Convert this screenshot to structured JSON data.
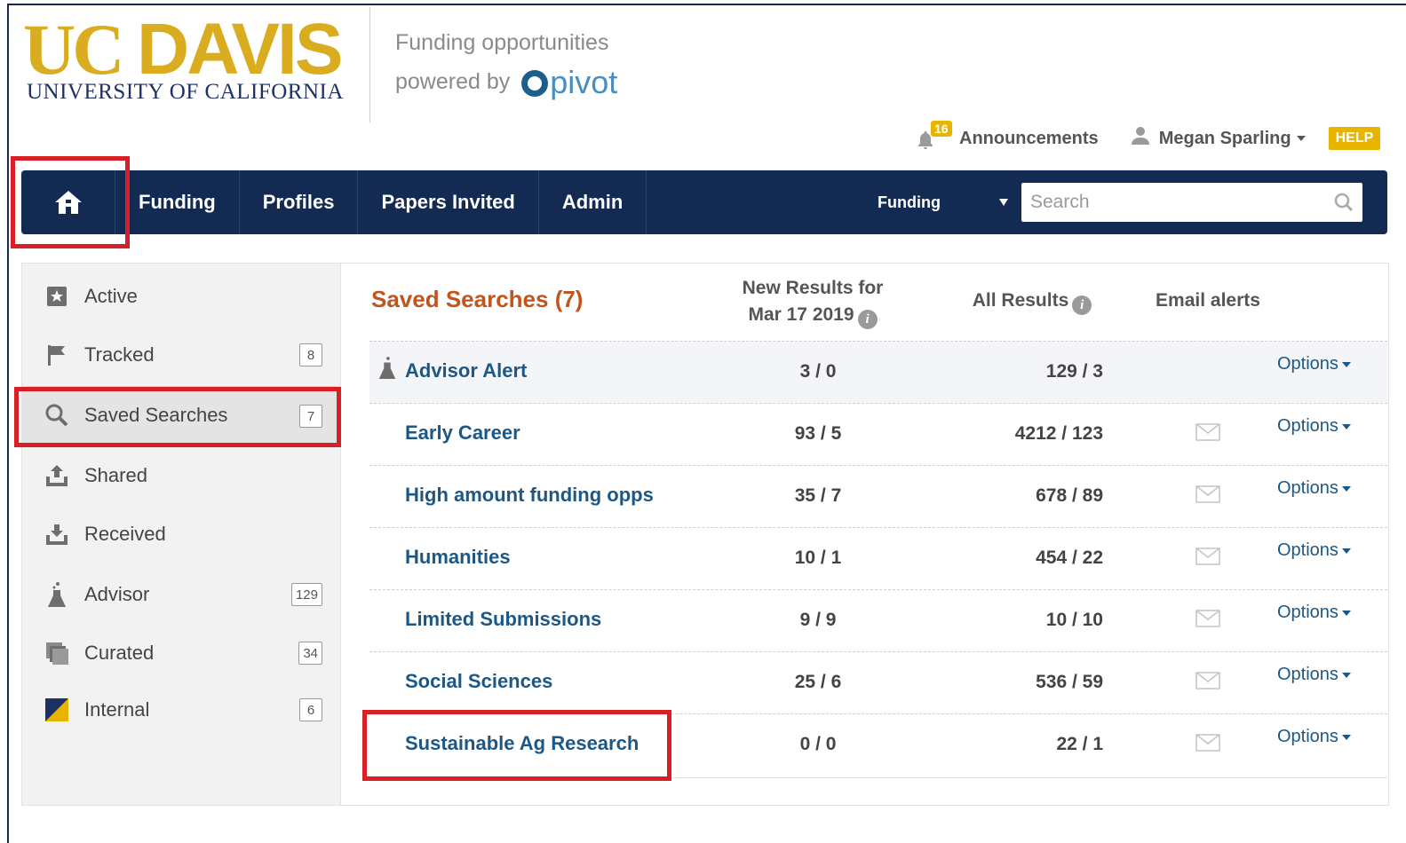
{
  "logo": {
    "uc": "UC",
    "davis": "DAVIS",
    "sub": "UNIVERSITY OF CALIFORNIA"
  },
  "tagline": {
    "line1": "Funding opportunities",
    "line2": "powered by",
    "brand": "pivot"
  },
  "toplinks": {
    "announcements_count": "16",
    "announcements_label": "Announcements",
    "user_name": "Megan Sparling",
    "help_label": "HELP"
  },
  "nav": {
    "items": [
      "Funding",
      "Profiles",
      "Papers Invited",
      "Admin"
    ],
    "scope_select": "Funding",
    "search_placeholder": "Search"
  },
  "sidebar": {
    "items": [
      {
        "label": "Active",
        "icon": "star-icon",
        "count": ""
      },
      {
        "label": "Tracked",
        "icon": "flag-icon",
        "count": "8"
      },
      {
        "label": "Saved Searches",
        "icon": "search-icon",
        "count": "7",
        "selected": true
      },
      {
        "label": "Shared",
        "icon": "share-upload-icon",
        "count": ""
      },
      {
        "label": "Received",
        "icon": "inbox-download-icon",
        "count": ""
      },
      {
        "label": "Advisor",
        "icon": "advisor-icon",
        "count": "129"
      },
      {
        "label": "Curated",
        "icon": "curated-stack-icon",
        "count": "34"
      },
      {
        "label": "Internal",
        "icon": "internal-flag-icon",
        "count": "6"
      }
    ]
  },
  "main": {
    "title": "Saved Searches  (7)",
    "col_new_line1": "New Results for",
    "col_new_line2": "Mar 17 2019",
    "col_all": "All Results",
    "col_email": "Email alerts",
    "options_label": "Options",
    "rows": [
      {
        "name": "Advisor Alert",
        "new": "3 / 0",
        "all": "129 / 3",
        "advisor": true
      },
      {
        "name": "Early Career",
        "new": "93 / 5",
        "all": "4212 / 123"
      },
      {
        "name": "High amount funding opps",
        "new": "35 / 7",
        "all": "678 / 89"
      },
      {
        "name": "Humanities",
        "new": "10 / 1",
        "all": "454 / 22"
      },
      {
        "name": "Limited Submissions",
        "new": "9 / 9",
        "all": "10 / 10"
      },
      {
        "name": "Social Sciences",
        "new": "25 / 6",
        "all": "536 / 59"
      },
      {
        "name": "Sustainable Ag Research",
        "new": "0 / 0",
        "all": "22 / 1"
      }
    ]
  },
  "colors": {
    "navbar": "#132a52",
    "title_orange": "#c0551d",
    "link_blue": "#1c5785",
    "ucd_gold": "#d9ad1f",
    "highlight_red": "#d81f26",
    "help_yellow": "#e8b400"
  }
}
